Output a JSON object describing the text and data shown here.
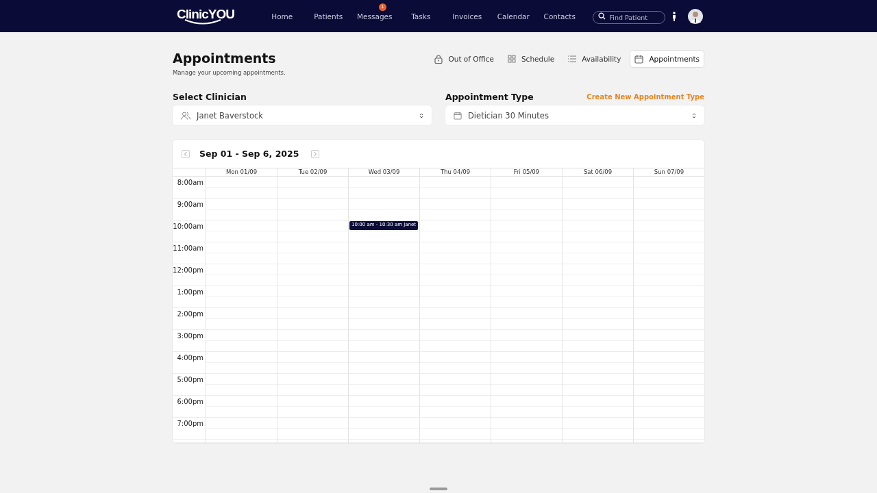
{
  "nav": {
    "logo": "ClinicYOU",
    "links": [
      {
        "label": "Home"
      },
      {
        "label": "Patients"
      },
      {
        "label": "Messages",
        "badge": "1"
      },
      {
        "label": "Tasks"
      },
      {
        "label": "Invoices"
      },
      {
        "label": "Calendar"
      },
      {
        "label": "Contacts"
      }
    ],
    "search": {
      "placeholder": "Find Patient"
    }
  },
  "page": {
    "title": "Appointments",
    "subtitle": "Manage your upcoming appointments."
  },
  "views": [
    {
      "label": "Out of Office",
      "kind": "lock",
      "selected": false
    },
    {
      "label": "Schedule",
      "kind": "grid",
      "selected": false
    },
    {
      "label": "Availability",
      "kind": "list",
      "selected": false
    },
    {
      "label": "Appointments",
      "kind": "calendar",
      "selected": true
    }
  ],
  "clinician": {
    "label": "Select Clinician",
    "value": "Janet Baverstock"
  },
  "appointment_type": {
    "label": "Appointment Type",
    "value": "Dietician 30 Minutes",
    "link": "Create New Appointment Type"
  },
  "calendar": {
    "range": "Sep 01 - Sep 6, 2025",
    "days": [
      "Mon 01/09",
      "Tue 02/09",
      "Wed 03/09",
      "Thu 04/09",
      "Fri 05/09",
      "Sat 06/09",
      "Sun 07/09"
    ],
    "hours": [
      {
        "time": "8:00am",
        "cells": [
          {
            "kind": "free"
          },
          {
            "kind": "free"
          },
          {
            "kind": "free"
          },
          {
            "kind": "free"
          },
          {
            "kind": "free"
          },
          {
            "kind": "free"
          },
          {
            "kind": "free"
          }
        ]
      },
      {
        "time": "9:00am",
        "cells": [
          {
            "kind": "free"
          },
          {
            "kind": "free"
          },
          {
            "kind": "free"
          },
          {
            "kind": "free"
          },
          {
            "kind": "free"
          },
          {
            "kind": "free"
          },
          {
            "kind": "free"
          }
        ]
      },
      {
        "time": "10:00am",
        "cells": [
          {
            "kind": "free"
          },
          {
            "kind": "free"
          },
          {
            "kind": "booked",
            "text": "10:00 am - 10:30 am Janet"
          },
          {
            "kind": "free"
          },
          {
            "kind": "free"
          },
          {
            "kind": "free"
          },
          {
            "kind": "free"
          }
        ]
      },
      {
        "time": "11:00am",
        "cells": [
          {
            "kind": "free"
          },
          {
            "kind": "free"
          },
          {
            "kind": "free"
          },
          {
            "kind": "free"
          },
          {
            "kind": "free"
          },
          {
            "kind": "free"
          },
          {
            "kind": "free"
          }
        ]
      },
      {
        "time": "12:00pm",
        "cells": [
          {
            "kind": "free"
          },
          {
            "kind": "free"
          },
          {
            "kind": "free"
          },
          {
            "kind": "free"
          },
          {
            "kind": "free"
          },
          {
            "kind": "free"
          },
          {
            "kind": "free"
          }
        ]
      },
      {
        "time": "1:00pm",
        "cells": [
          {
            "kind": "free"
          },
          {
            "kind": "free"
          },
          {
            "kind": "free"
          },
          {
            "kind": "free"
          },
          {
            "kind": "free"
          },
          {
            "kind": "free"
          },
          {
            "kind": "free"
          }
        ]
      },
      {
        "time": "2:00pm",
        "cells": [
          {
            "kind": "free"
          },
          {
            "kind": "free"
          },
          {
            "kind": "free"
          },
          {
            "kind": "free"
          },
          {
            "kind": "free"
          },
          {
            "kind": "free"
          },
          {
            "kind": "free"
          }
        ]
      },
      {
        "time": "3:00pm",
        "cells": [
          {
            "kind": "free"
          },
          {
            "kind": "free"
          },
          {
            "kind": "free"
          },
          {
            "kind": "free"
          },
          {
            "kind": "free"
          },
          {
            "kind": "free"
          },
          {
            "kind": "free"
          }
        ]
      },
      {
        "time": "4:00pm",
        "cells": [
          {
            "kind": "free"
          },
          {
            "kind": "free"
          },
          {
            "kind": "free"
          },
          {
            "kind": "free"
          },
          {
            "kind": "free"
          },
          {
            "kind": "free"
          },
          {
            "kind": "free"
          }
        ]
      },
      {
        "time": "5:00pm",
        "cells": [
          {
            "kind": "free"
          },
          {
            "kind": "free"
          },
          {
            "kind": "free"
          },
          {
            "kind": "free"
          },
          {
            "kind": "free"
          },
          {
            "kind": "free"
          },
          {
            "kind": "free"
          }
        ]
      },
      {
        "time": "6:00pm",
        "cells": [
          {
            "kind": "free"
          },
          {
            "kind": "free"
          },
          {
            "kind": "free"
          },
          {
            "kind": "free"
          },
          {
            "kind": "free"
          },
          {
            "kind": "free"
          },
          {
            "kind": "free"
          }
        ]
      },
      {
        "time": "7:00pm",
        "cells": [
          {
            "kind": "free"
          },
          {
            "kind": "free"
          },
          {
            "kind": "free"
          },
          {
            "kind": "free"
          },
          {
            "kind": "free"
          },
          {
            "kind": "free"
          },
          {
            "kind": "free"
          }
        ]
      }
    ]
  }
}
